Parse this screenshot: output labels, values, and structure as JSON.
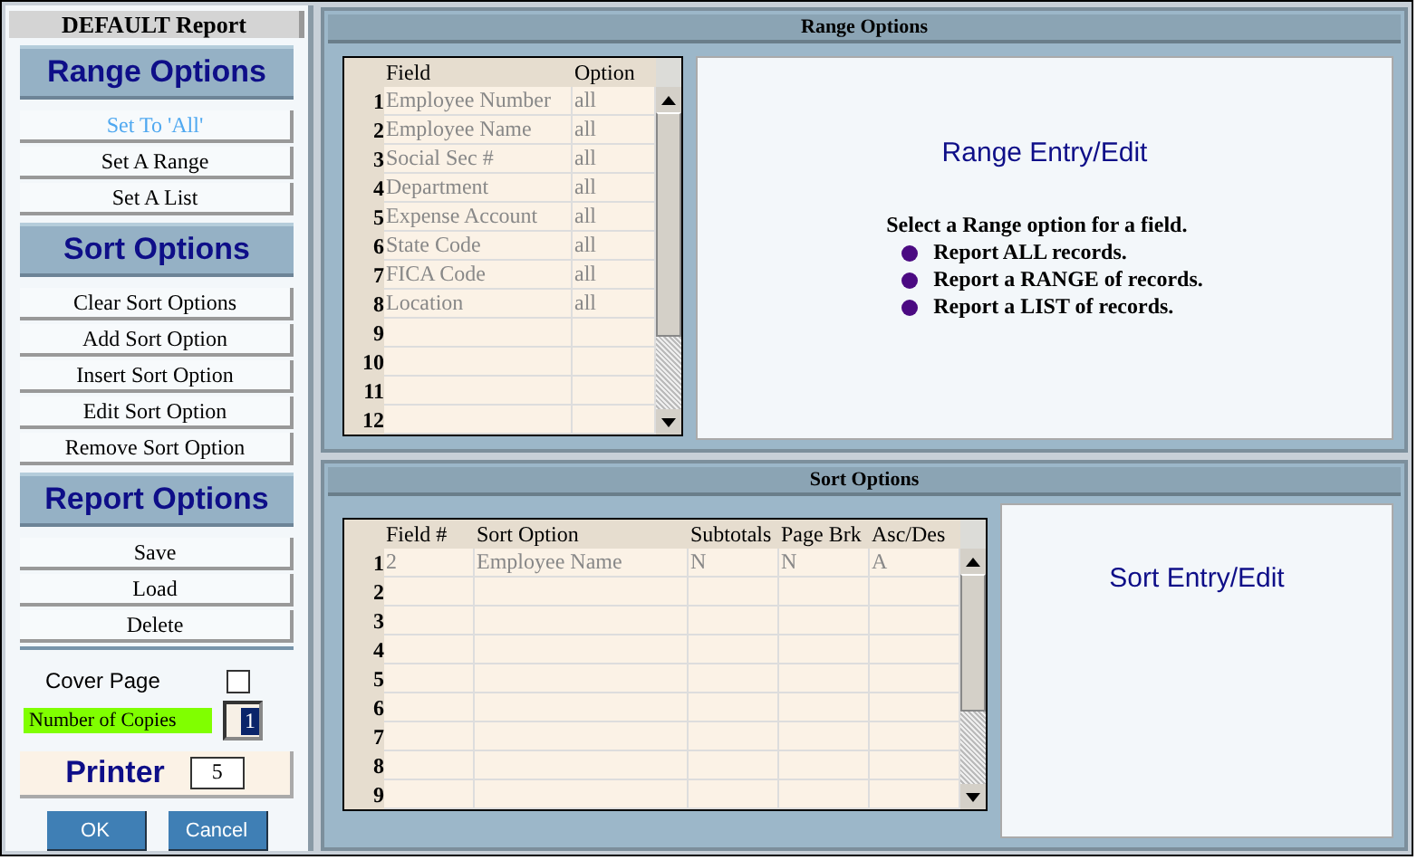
{
  "sidebar": {
    "title": "DEFAULT Report",
    "sections": [
      {
        "heading": "Range Options",
        "buttons": [
          {
            "label": "Set To 'All'",
            "disabled": true
          },
          {
            "label": "Set A Range",
            "disabled": false
          },
          {
            "label": "Set A List",
            "disabled": false
          }
        ]
      },
      {
        "heading": "Sort Options",
        "buttons": [
          {
            "label": "Clear Sort Options",
            "disabled": false
          },
          {
            "label": "Add Sort Option",
            "disabled": false
          },
          {
            "label": "Insert Sort Option",
            "disabled": false
          },
          {
            "label": "Edit Sort Option",
            "disabled": false
          },
          {
            "label": "Remove Sort Option",
            "disabled": false
          }
        ]
      },
      {
        "heading": "Report Options",
        "buttons": [
          {
            "label": "Save",
            "disabled": false
          },
          {
            "label": "Load",
            "disabled": false
          },
          {
            "label": "Delete",
            "disabled": false
          }
        ]
      }
    ],
    "cover_page": {
      "label": "Cover Page",
      "checked": false
    },
    "copies": {
      "label": "Number of Copies",
      "value": "1"
    },
    "printer": {
      "label": "Printer",
      "value": "5"
    },
    "buttons": [
      "OK",
      "Cancel"
    ]
  },
  "range_panel": {
    "title": "Range Options",
    "table": {
      "columns": [
        "Field",
        "Option"
      ],
      "rows": [
        {
          "number": "1",
          "cells": [
            "Employee Number",
            "all"
          ]
        },
        {
          "number": "2",
          "cells": [
            "Employee Name",
            "all"
          ]
        },
        {
          "number": "3",
          "cells": [
            "Social Sec #",
            "all"
          ]
        },
        {
          "number": "4",
          "cells": [
            "Department",
            "all"
          ]
        },
        {
          "number": "5",
          "cells": [
            "Expense Account",
            "all"
          ]
        },
        {
          "number": "6",
          "cells": [
            "State Code",
            "all"
          ]
        },
        {
          "number": "7",
          "cells": [
            "FICA Code",
            "all"
          ]
        },
        {
          "number": "8",
          "cells": [
            "Location",
            "all"
          ]
        },
        {
          "number": "9"
        },
        {
          "number": "10"
        },
        {
          "number": "11"
        },
        {
          "number": "12"
        }
      ]
    },
    "entry": {
      "title": "Range Entry/Edit",
      "intro": "Select a Range option for a field.",
      "bullets": [
        "Report ALL records.",
        "Report a RANGE of records.",
        "Report a LIST of records."
      ]
    }
  },
  "sort_panel": {
    "title": "Sort Options",
    "table": {
      "columns": [
        "Field #",
        "Sort Option",
        "Subtotals",
        "Page Brk",
        "Asc/Des"
      ],
      "rows": [
        {
          "number": "1",
          "cells": [
            "2",
            "Employee Name",
            "N",
            "N",
            "A"
          ]
        },
        {
          "number": "2"
        },
        {
          "number": "3"
        },
        {
          "number": "4"
        },
        {
          "number": "5"
        },
        {
          "number": "6"
        },
        {
          "number": "7"
        },
        {
          "number": "8"
        },
        {
          "number": "9"
        }
      ]
    },
    "entry": {
      "title": "Sort Entry/Edit"
    }
  }
}
